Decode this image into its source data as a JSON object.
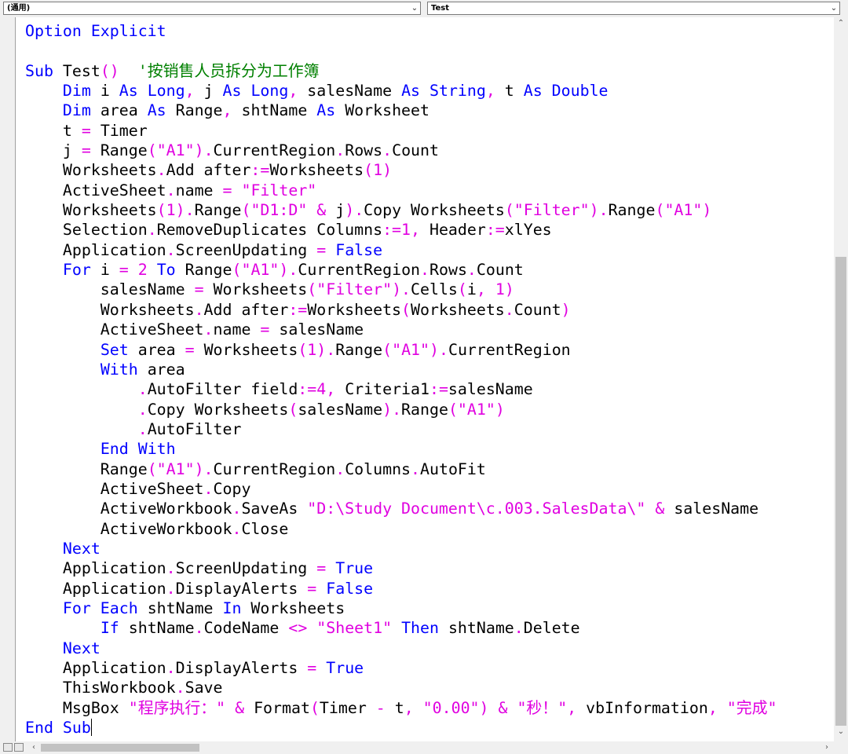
{
  "header": {
    "object_combo": "(通用)",
    "procedure_combo": "Test"
  },
  "editor": {
    "lines": [
      [
        {
          "t": "Option Explicit",
          "c": "kw"
        }
      ],
      [],
      [
        {
          "t": "Sub",
          "c": "kw"
        },
        {
          "t": " Test"
        },
        {
          "t": "()",
          "c": "op"
        },
        {
          "t": "  '按销售人员拆分为工作簿",
          "c": "cmt"
        }
      ],
      [
        {
          "t": "    "
        },
        {
          "t": "Dim",
          "c": "kw"
        },
        {
          "t": " i "
        },
        {
          "t": "As Long",
          "c": "kw"
        },
        {
          "t": ", ",
          "c": "op"
        },
        {
          "t": "j "
        },
        {
          "t": "As Long",
          "c": "kw"
        },
        {
          "t": ", ",
          "c": "op"
        },
        {
          "t": "salesName "
        },
        {
          "t": "As String",
          "c": "kw"
        },
        {
          "t": ", ",
          "c": "op"
        },
        {
          "t": "t "
        },
        {
          "t": "As Double",
          "c": "kw"
        }
      ],
      [
        {
          "t": "    "
        },
        {
          "t": "Dim",
          "c": "kw"
        },
        {
          "t": " area "
        },
        {
          "t": "As",
          "c": "kw"
        },
        {
          "t": " Range"
        },
        {
          "t": ", ",
          "c": "op"
        },
        {
          "t": "shtName "
        },
        {
          "t": "As",
          "c": "kw"
        },
        {
          "t": " Worksheet"
        }
      ],
      [
        {
          "t": "    t "
        },
        {
          "t": "=",
          "c": "op"
        },
        {
          "t": " Timer"
        }
      ],
      [
        {
          "t": "    j "
        },
        {
          "t": "=",
          "c": "op"
        },
        {
          "t": " Range"
        },
        {
          "t": "(",
          "c": "op"
        },
        {
          "t": "\"A1\"",
          "c": "str"
        },
        {
          "t": ").",
          "c": "op"
        },
        {
          "t": "CurrentRegion"
        },
        {
          "t": ".",
          "c": "op"
        },
        {
          "t": "Rows"
        },
        {
          "t": ".",
          "c": "op"
        },
        {
          "t": "Count"
        }
      ],
      [
        {
          "t": "    Worksheets"
        },
        {
          "t": ".",
          "c": "op"
        },
        {
          "t": "Add after"
        },
        {
          "t": ":=",
          "c": "op"
        },
        {
          "t": "Worksheets"
        },
        {
          "t": "(1)",
          "c": "op"
        }
      ],
      [
        {
          "t": "    ActiveSheet"
        },
        {
          "t": ".",
          "c": "op"
        },
        {
          "t": "name "
        },
        {
          "t": "=",
          "c": "op"
        },
        {
          "t": " "
        },
        {
          "t": "\"Filter\"",
          "c": "str"
        }
      ],
      [
        {
          "t": "    Worksheets"
        },
        {
          "t": "(1).",
          "c": "op"
        },
        {
          "t": "Range"
        },
        {
          "t": "(",
          "c": "op"
        },
        {
          "t": "\"D1:D\"",
          "c": "str"
        },
        {
          "t": " & ",
          "c": "op"
        },
        {
          "t": "j"
        },
        {
          "t": ").",
          "c": "op"
        },
        {
          "t": "Copy Worksheets"
        },
        {
          "t": "(",
          "c": "op"
        },
        {
          "t": "\"Filter\"",
          "c": "str"
        },
        {
          "t": ").",
          "c": "op"
        },
        {
          "t": "Range"
        },
        {
          "t": "(",
          "c": "op"
        },
        {
          "t": "\"A1\"",
          "c": "str"
        },
        {
          "t": ")",
          "c": "op"
        }
      ],
      [
        {
          "t": "    Selection"
        },
        {
          "t": ".",
          "c": "op"
        },
        {
          "t": "RemoveDuplicates Columns"
        },
        {
          "t": ":=1, ",
          "c": "op"
        },
        {
          "t": "Header"
        },
        {
          "t": ":=",
          "c": "op"
        },
        {
          "t": "xlYes"
        }
      ],
      [
        {
          "t": "    Application"
        },
        {
          "t": ".",
          "c": "op"
        },
        {
          "t": "ScreenUpdating "
        },
        {
          "t": "=",
          "c": "op"
        },
        {
          "t": " "
        },
        {
          "t": "False",
          "c": "kw"
        }
      ],
      [
        {
          "t": "    "
        },
        {
          "t": "For",
          "c": "kw"
        },
        {
          "t": " i "
        },
        {
          "t": "= 2 ",
          "c": "op"
        },
        {
          "t": "To",
          "c": "kw"
        },
        {
          "t": " Range"
        },
        {
          "t": "(",
          "c": "op"
        },
        {
          "t": "\"A1\"",
          "c": "str"
        },
        {
          "t": ").",
          "c": "op"
        },
        {
          "t": "CurrentRegion"
        },
        {
          "t": ".",
          "c": "op"
        },
        {
          "t": "Rows"
        },
        {
          "t": ".",
          "c": "op"
        },
        {
          "t": "Count"
        }
      ],
      [
        {
          "t": "        salesName "
        },
        {
          "t": "=",
          "c": "op"
        },
        {
          "t": " Worksheets"
        },
        {
          "t": "(",
          "c": "op"
        },
        {
          "t": "\"Filter\"",
          "c": "str"
        },
        {
          "t": ").",
          "c": "op"
        },
        {
          "t": "Cells"
        },
        {
          "t": "(",
          "c": "op"
        },
        {
          "t": "i"
        },
        {
          "t": ", 1)",
          "c": "op"
        }
      ],
      [
        {
          "t": "        Worksheets"
        },
        {
          "t": ".",
          "c": "op"
        },
        {
          "t": "Add after"
        },
        {
          "t": ":=",
          "c": "op"
        },
        {
          "t": "Worksheets"
        },
        {
          "t": "(",
          "c": "op"
        },
        {
          "t": "Worksheets"
        },
        {
          "t": ".",
          "c": "op"
        },
        {
          "t": "Count"
        },
        {
          "t": ")",
          "c": "op"
        }
      ],
      [
        {
          "t": "        ActiveSheet"
        },
        {
          "t": ".",
          "c": "op"
        },
        {
          "t": "name "
        },
        {
          "t": "=",
          "c": "op"
        },
        {
          "t": " salesName"
        }
      ],
      [
        {
          "t": "        "
        },
        {
          "t": "Set",
          "c": "kw"
        },
        {
          "t": " area "
        },
        {
          "t": "=",
          "c": "op"
        },
        {
          "t": " Worksheets"
        },
        {
          "t": "(1).",
          "c": "op"
        },
        {
          "t": "Range"
        },
        {
          "t": "(",
          "c": "op"
        },
        {
          "t": "\"A1\"",
          "c": "str"
        },
        {
          "t": ").",
          "c": "op"
        },
        {
          "t": "CurrentRegion"
        }
      ],
      [
        {
          "t": "        "
        },
        {
          "t": "With",
          "c": "kw"
        },
        {
          "t": " area"
        }
      ],
      [
        {
          "t": "            "
        },
        {
          "t": ".",
          "c": "op"
        },
        {
          "t": "AutoFilter field"
        },
        {
          "t": ":=4, ",
          "c": "op"
        },
        {
          "t": "Criteria1"
        },
        {
          "t": ":=",
          "c": "op"
        },
        {
          "t": "salesName"
        }
      ],
      [
        {
          "t": "            "
        },
        {
          "t": ".",
          "c": "op"
        },
        {
          "t": "Copy Worksheets"
        },
        {
          "t": "(",
          "c": "op"
        },
        {
          "t": "salesName"
        },
        {
          "t": ").",
          "c": "op"
        },
        {
          "t": "Range"
        },
        {
          "t": "(",
          "c": "op"
        },
        {
          "t": "\"A1\"",
          "c": "str"
        },
        {
          "t": ")",
          "c": "op"
        }
      ],
      [
        {
          "t": "            "
        },
        {
          "t": ".",
          "c": "op"
        },
        {
          "t": "AutoFilter"
        }
      ],
      [
        {
          "t": "        "
        },
        {
          "t": "End With",
          "c": "kw"
        }
      ],
      [
        {
          "t": "        Range"
        },
        {
          "t": "(",
          "c": "op"
        },
        {
          "t": "\"A1\"",
          "c": "str"
        },
        {
          "t": ").",
          "c": "op"
        },
        {
          "t": "CurrentRegion"
        },
        {
          "t": ".",
          "c": "op"
        },
        {
          "t": "Columns"
        },
        {
          "t": ".",
          "c": "op"
        },
        {
          "t": "AutoFit"
        }
      ],
      [
        {
          "t": "        ActiveSheet"
        },
        {
          "t": ".",
          "c": "op"
        },
        {
          "t": "Copy"
        }
      ],
      [
        {
          "t": "        ActiveWorkbook"
        },
        {
          "t": ".",
          "c": "op"
        },
        {
          "t": "SaveAs "
        },
        {
          "t": "\"D:\\Study Document\\c.003.SalesData\\\"",
          "c": "str"
        },
        {
          "t": " & ",
          "c": "op"
        },
        {
          "t": "salesName"
        }
      ],
      [
        {
          "t": "        ActiveWorkbook"
        },
        {
          "t": ".",
          "c": "op"
        },
        {
          "t": "Close"
        }
      ],
      [
        {
          "t": "    "
        },
        {
          "t": "Next",
          "c": "kw"
        }
      ],
      [
        {
          "t": "    Application"
        },
        {
          "t": ".",
          "c": "op"
        },
        {
          "t": "ScreenUpdating "
        },
        {
          "t": "=",
          "c": "op"
        },
        {
          "t": " "
        },
        {
          "t": "True",
          "c": "kw"
        }
      ],
      [
        {
          "t": "    Application"
        },
        {
          "t": ".",
          "c": "op"
        },
        {
          "t": "DisplayAlerts "
        },
        {
          "t": "=",
          "c": "op"
        },
        {
          "t": " "
        },
        {
          "t": "False",
          "c": "kw"
        }
      ],
      [
        {
          "t": "    "
        },
        {
          "t": "For Each",
          "c": "kw"
        },
        {
          "t": " shtName "
        },
        {
          "t": "In",
          "c": "kw"
        },
        {
          "t": " Worksheets"
        }
      ],
      [
        {
          "t": "        "
        },
        {
          "t": "If",
          "c": "kw"
        },
        {
          "t": " shtName"
        },
        {
          "t": ".",
          "c": "op"
        },
        {
          "t": "CodeName "
        },
        {
          "t": "<>",
          "c": "op"
        },
        {
          "t": " "
        },
        {
          "t": "\"Sheet1\"",
          "c": "str"
        },
        {
          "t": " "
        },
        {
          "t": "Then",
          "c": "kw"
        },
        {
          "t": " shtName"
        },
        {
          "t": ".",
          "c": "op"
        },
        {
          "t": "Delete"
        }
      ],
      [
        {
          "t": "    "
        },
        {
          "t": "Next",
          "c": "kw"
        }
      ],
      [
        {
          "t": "    Application"
        },
        {
          "t": ".",
          "c": "op"
        },
        {
          "t": "DisplayAlerts "
        },
        {
          "t": "=",
          "c": "op"
        },
        {
          "t": " "
        },
        {
          "t": "True",
          "c": "kw"
        }
      ],
      [
        {
          "t": "    ThisWorkbook"
        },
        {
          "t": ".",
          "c": "op"
        },
        {
          "t": "Save"
        }
      ],
      [
        {
          "t": "    MsgBox "
        },
        {
          "t": "\"程序执行：\"",
          "c": "str"
        },
        {
          "t": " & ",
          "c": "op"
        },
        {
          "t": "Format"
        },
        {
          "t": "(",
          "c": "op"
        },
        {
          "t": "Timer "
        },
        {
          "t": "-",
          "c": "op"
        },
        {
          "t": " t"
        },
        {
          "t": ", ",
          "c": "op"
        },
        {
          "t": "\"0.00\"",
          "c": "str"
        },
        {
          "t": ") & ",
          "c": "op"
        },
        {
          "t": "\"秒！\"",
          "c": "str"
        },
        {
          "t": ", ",
          "c": "op"
        },
        {
          "t": "vbInformation"
        },
        {
          "t": ", ",
          "c": "op"
        },
        {
          "t": "\"完成\"",
          "c": "str"
        }
      ],
      [
        {
          "t": "End Sub",
          "c": "kw"
        }
      ]
    ]
  },
  "scroll": {
    "vertical_position_fraction": 0.32,
    "horizontal_position_fraction": 0.0
  },
  "icons": {
    "combo_arrow": "chevron-down-icon",
    "scroll_up": "arrow-up-icon",
    "scroll_down": "arrow-down-icon",
    "scroll_left": "arrow-left-icon",
    "scroll_right": "arrow-right-icon"
  },
  "colors": {
    "keyword": "#0000ff",
    "string": "#e000e0",
    "comment": "#008000",
    "text": "#000000",
    "background": "#ffffff"
  }
}
